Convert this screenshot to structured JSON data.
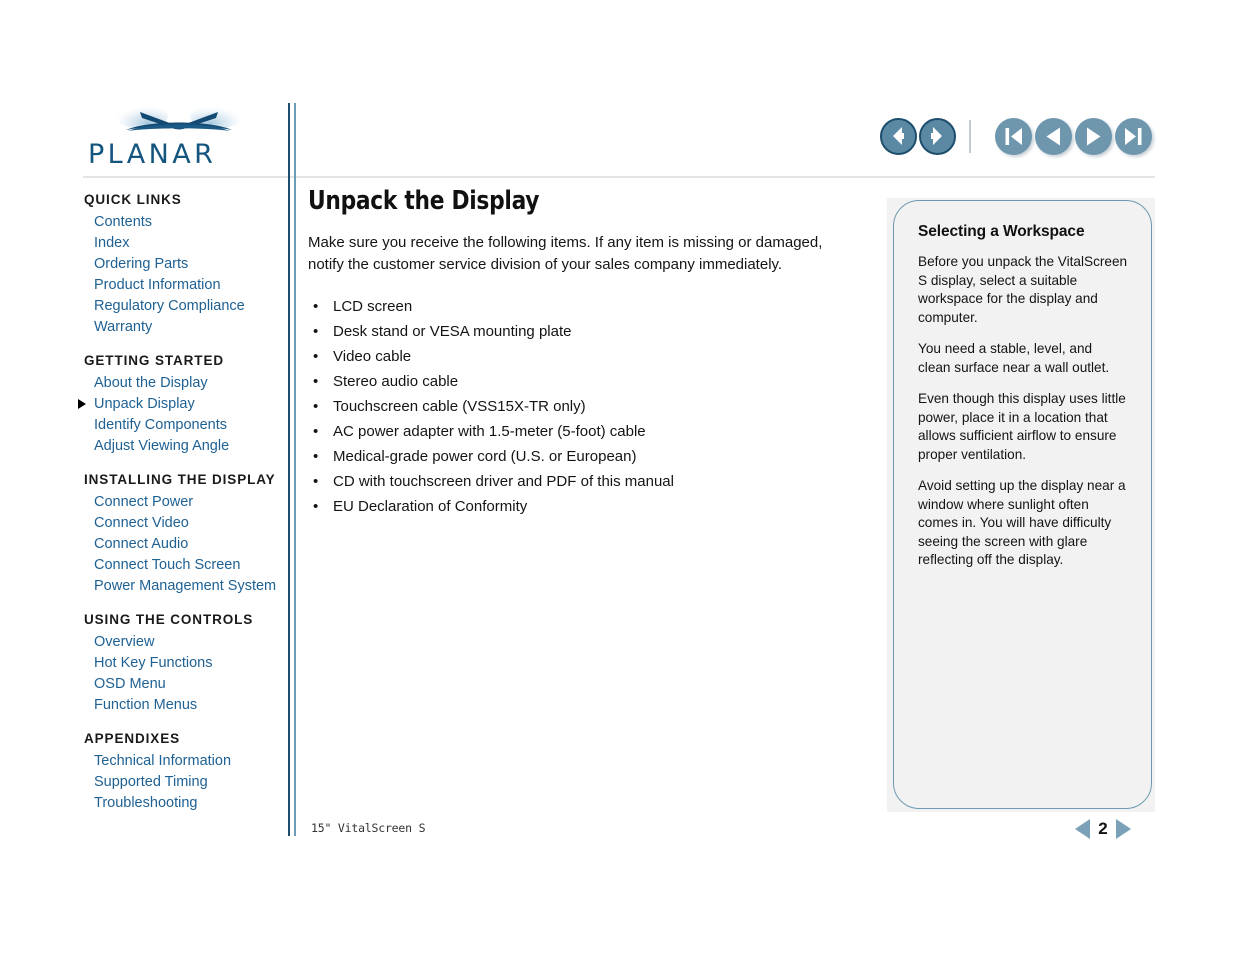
{
  "brand": {
    "name": "PLANAR",
    "logo_mark": "planar-wing-logo",
    "color": "#1b4f72"
  },
  "toolbar": {
    "history": [
      {
        "name": "back-button",
        "icon": "arrow-left-icon",
        "label": "Back"
      },
      {
        "name": "forward-button",
        "icon": "arrow-right-icon",
        "label": "Forward"
      }
    ],
    "pager_controls": [
      {
        "name": "first-page-button",
        "icon": "skip-to-start-icon",
        "label": "First Page"
      },
      {
        "name": "previous-page-button",
        "icon": "triangle-left-icon",
        "label": "Previous Page"
      },
      {
        "name": "next-page-button",
        "icon": "triangle-right-icon",
        "label": "Next Page"
      },
      {
        "name": "last-page-button",
        "icon": "skip-to-end-icon",
        "label": "Last Page"
      }
    ]
  },
  "sidebar": {
    "groups": [
      {
        "heading": "QUICK LINKS",
        "items": [
          {
            "label": "Contents",
            "active": false
          },
          {
            "label": "Index",
            "active": false
          },
          {
            "label": "Ordering Parts",
            "active": false
          },
          {
            "label": "Product Information",
            "active": false
          },
          {
            "label": "Regulatory Compliance",
            "active": false
          },
          {
            "label": "Warranty",
            "active": false
          }
        ]
      },
      {
        "heading": "GETTING STARTED",
        "items": [
          {
            "label": "About the Display",
            "active": false
          },
          {
            "label": "Unpack Display",
            "active": true
          },
          {
            "label": "Identify Components",
            "active": false
          },
          {
            "label": "Adjust Viewing Angle",
            "active": false
          }
        ]
      },
      {
        "heading": "INSTALLING THE DISPLAY",
        "items": [
          {
            "label": "Connect Power",
            "active": false
          },
          {
            "label": "Connect Video",
            "active": false
          },
          {
            "label": "Connect Audio",
            "active": false
          },
          {
            "label": "Connect Touch Screen",
            "active": false
          },
          {
            "label": "Power Management System",
            "active": false
          }
        ]
      },
      {
        "heading": "USING THE CONTROLS",
        "items": [
          {
            "label": "Overview",
            "active": false
          },
          {
            "label": "Hot Key Functions",
            "active": false
          },
          {
            "label": "OSD Menu",
            "active": false
          },
          {
            "label": "Function Menus",
            "active": false
          }
        ]
      },
      {
        "heading": "APPENDIXES",
        "items": [
          {
            "label": "Technical Information",
            "active": false
          },
          {
            "label": "Supported Timing",
            "active": false
          },
          {
            "label": "Troubleshooting",
            "active": false
          }
        ]
      }
    ]
  },
  "main": {
    "title": "Unpack the Display",
    "intro": "Make sure you receive the following items. If any item is missing or damaged, notify the customer service division of your sales company immediately.",
    "items": [
      "LCD screen",
      "Desk stand or VESA mounting plate",
      "Video cable",
      "Stereo audio cable",
      "Touchscreen cable (VSS15X-TR only)",
      "AC power adapter with 1.5-meter (5-foot) cable",
      "Medical-grade power cord (U.S. or European)",
      "CD with touchscreen driver and PDF of this manual",
      "EU Declaration of Conformity"
    ]
  },
  "callout": {
    "title": "Selecting a Workspace",
    "paragraphs": [
      "Before you unpack the VitalScreen S display, select a suitable workspace for the display and computer.",
      "You need a stable, level, and clean surface near a wall outlet.",
      "Even though this display uses little power, place it in a location that allows sufficient airflow to ensure proper ventilation.",
      "Avoid setting up the display near a window where sunlight often comes in. You will have difficulty seeing the screen with glare reflecting off the display."
    ]
  },
  "footer": {
    "product_label": "15\" VitalScreen S",
    "page_number": "2",
    "prev_icon": "triangle-left-icon",
    "next_icon": "triangle-right-icon"
  }
}
